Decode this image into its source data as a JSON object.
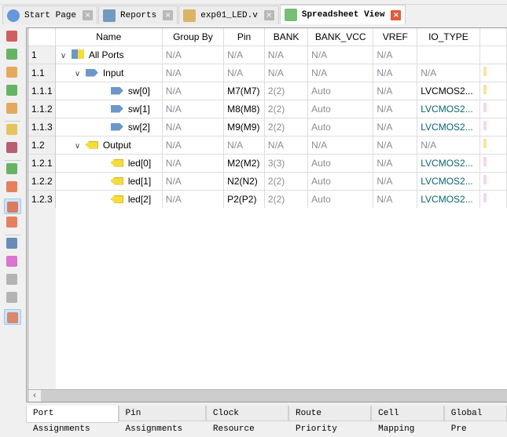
{
  "editor_tabs": [
    {
      "label": "Start Page",
      "icon": "start-page-icon",
      "active": false
    },
    {
      "label": "Reports",
      "icon": "reports-icon",
      "active": false
    },
    {
      "label": "exp01_LED.v",
      "icon": "verilog-file-icon",
      "active": false
    },
    {
      "label": "Spreadsheet View",
      "icon": "spreadsheet-icon",
      "active": true
    }
  ],
  "close_glyph": "×",
  "toolbar_icons": [
    "no-clock-icon",
    "clock-icon",
    "clock-gate-icon",
    "clock-x2-icon",
    "clock-buffer-icon",
    "import-folder-icon",
    "waveform-icon",
    "export-icon",
    "warning-port-icon",
    "warning-filter-icon",
    "chip-warning-icon",
    "sort-az-icon",
    "magic-icon",
    "group-icon",
    "ungroup-icon",
    "color-icon"
  ],
  "grid": {
    "columns": [
      "",
      "Name",
      "Group By",
      "Pin",
      "BANK",
      "BANK_VCC",
      "VREF",
      "IO_TYPE"
    ],
    "sort_indicator": "^",
    "rows": [
      {
        "num": "1",
        "name": "All Ports",
        "level": 0,
        "kind": "group-all",
        "expanded": true,
        "group_by": "N/A",
        "pin": "N/A",
        "bank": "N/A",
        "bank_vcc": "N/A",
        "vref": "N/A",
        "io_type": ""
      },
      {
        "num": "1.1",
        "name": "Input",
        "level": 1,
        "kind": "in",
        "expanded": true,
        "group_by": "N/A",
        "pin": "N/A",
        "bank": "N/A",
        "bank_vcc": "N/A",
        "vref": "N/A",
        "io_type": "N/A"
      },
      {
        "num": "1.1.1",
        "name": "sw[0]",
        "level": 2,
        "kind": "in",
        "group_by": "N/A",
        "pin": "M7(M7)",
        "bank": "2(2)",
        "bank_vcc": "Auto",
        "vref": "N/A",
        "io_type": "LVCMOS2..."
      },
      {
        "num": "1.1.2",
        "name": "sw[1]",
        "level": 2,
        "kind": "in",
        "group_by": "N/A",
        "pin": "M8(M8)",
        "bank": "2(2)",
        "bank_vcc": "Auto",
        "vref": "N/A",
        "io_type": "LVCMOS2..."
      },
      {
        "num": "1.1.3",
        "name": "sw[2]",
        "level": 2,
        "kind": "in",
        "group_by": "N/A",
        "pin": "M9(M9)",
        "bank": "2(2)",
        "bank_vcc": "Auto",
        "vref": "N/A",
        "io_type": "LVCMOS2..."
      },
      {
        "num": "1.2",
        "name": "Output",
        "level": 1,
        "kind": "out",
        "expanded": true,
        "group_by": "N/A",
        "pin": "N/A",
        "bank": "N/A",
        "bank_vcc": "N/A",
        "vref": "N/A",
        "io_type": "N/A"
      },
      {
        "num": "1.2.1",
        "name": "led[0]",
        "level": 2,
        "kind": "out",
        "group_by": "N/A",
        "pin": "M2(M2)",
        "bank": "3(3)",
        "bank_vcc": "Auto",
        "vref": "N/A",
        "io_type": "LVCMOS2..."
      },
      {
        "num": "1.2.2",
        "name": "led[1]",
        "level": 2,
        "kind": "out",
        "group_by": "N/A",
        "pin": "N2(N2)",
        "bank": "2(2)",
        "bank_vcc": "Auto",
        "vref": "N/A",
        "io_type": "LVCMOS2..."
      },
      {
        "num": "1.2.3",
        "name": "led[2]",
        "level": 2,
        "kind": "out",
        "group_by": "N/A",
        "pin": "P2(P2)",
        "bank": "2(2)",
        "bank_vcc": "Auto",
        "vref": "N/A",
        "io_type": "LVCMOS2..."
      }
    ]
  },
  "scroll_left": "‹",
  "bottom_tabs": [
    "Port Assignments",
    "Pin Assignments",
    "Clock Resource",
    "Route Priority",
    "Cell Mapping",
    "Global Pre"
  ],
  "colors": {
    "input_port": "#6d97c8",
    "output_port": "#f5dc3c",
    "io_type_text": "#0a6470",
    "na_text": "#8a8a9a"
  }
}
